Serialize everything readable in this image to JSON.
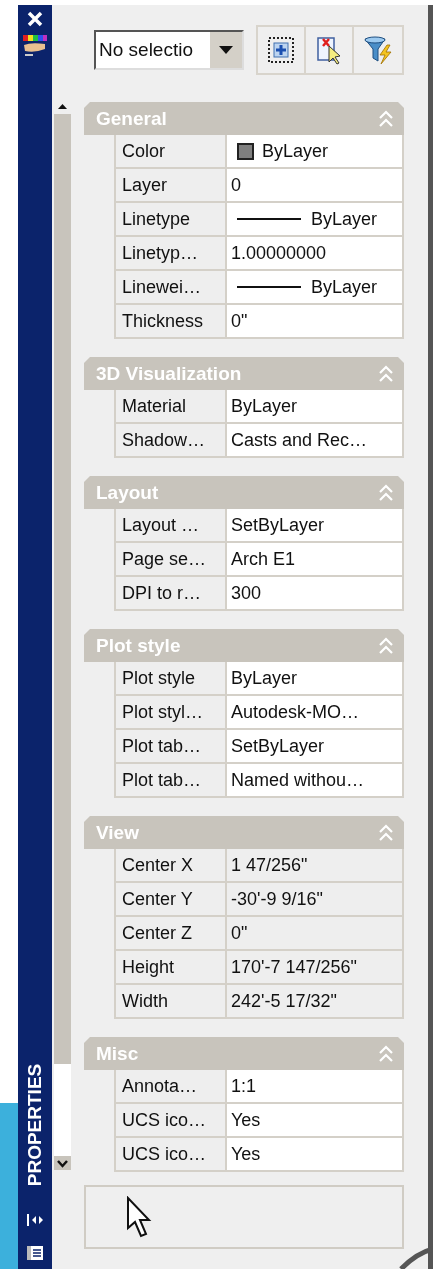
{
  "palette": {
    "title": "PROPERTIES"
  },
  "selector": {
    "value": "No selectio"
  },
  "sections": [
    {
      "title": "General",
      "expanded": true,
      "rows": [
        {
          "label": "Color",
          "value": "ByLayer",
          "kind": "color",
          "readonly": false
        },
        {
          "label": "Layer",
          "value": "0",
          "kind": "text",
          "readonly": false
        },
        {
          "label": "Linetype",
          "value": "ByLayer",
          "kind": "line",
          "readonly": false
        },
        {
          "label": "Linetyp…",
          "value": "1.00000000",
          "kind": "text",
          "readonly": false
        },
        {
          "label": "Linewei…",
          "value": "ByLayer",
          "kind": "line",
          "readonly": false
        },
        {
          "label": "Thickness",
          "value": "0\"",
          "kind": "text",
          "readonly": false
        }
      ]
    },
    {
      "title": "3D Visualization",
      "expanded": true,
      "rows": [
        {
          "label": "Material",
          "value": "ByLayer",
          "kind": "text",
          "readonly": false
        },
        {
          "label": "Shadow…",
          "value": "Casts and Rec…",
          "kind": "text",
          "readonly": false
        }
      ]
    },
    {
      "title": "Layout",
      "expanded": true,
      "rows": [
        {
          "label": "Layout …",
          "value": "SetByLayer",
          "kind": "text",
          "readonly": false
        },
        {
          "label": "Page se…",
          "value": "Arch E1",
          "kind": "text",
          "readonly": false
        },
        {
          "label": "DPI to r…",
          "value": "300",
          "kind": "text",
          "readonly": false
        }
      ]
    },
    {
      "title": "Plot style",
      "expanded": true,
      "rows": [
        {
          "label": "Plot style",
          "value": "ByLayer",
          "kind": "text",
          "readonly": false
        },
        {
          "label": "Plot styl…",
          "value": "Autodesk-MO…",
          "kind": "text",
          "readonly": false
        },
        {
          "label": "Plot tab…",
          "value": "SetByLayer",
          "kind": "text",
          "readonly": false
        },
        {
          "label": "Plot tab…",
          "value": "Named withou…",
          "kind": "text",
          "readonly": false
        }
      ]
    },
    {
      "title": "View",
      "expanded": true,
      "rows": [
        {
          "label": "Center X",
          "value": "1 47/256\"",
          "kind": "text",
          "readonly": true
        },
        {
          "label": "Center Y",
          "value": "-30'-9 9/16\"",
          "kind": "text",
          "readonly": true
        },
        {
          "label": "Center Z",
          "value": "0\"",
          "kind": "text",
          "readonly": true
        },
        {
          "label": "Height",
          "value": "170'-7 147/256\"",
          "kind": "text",
          "readonly": true
        },
        {
          "label": "Width",
          "value": "242'-5 17/32\"",
          "kind": "text",
          "readonly": true
        }
      ]
    },
    {
      "title": "Misc",
      "expanded": true,
      "rows": [
        {
          "label": "Annota…",
          "value": "1:1",
          "kind": "text",
          "readonly": false
        },
        {
          "label": "UCS ico…",
          "value": "Yes",
          "kind": "text",
          "readonly": false
        },
        {
          "label": "UCS ico…",
          "value": "Yes",
          "kind": "text",
          "readonly": false
        }
      ]
    }
  ]
}
